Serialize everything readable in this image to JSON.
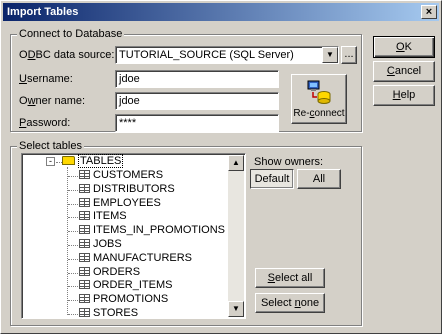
{
  "dialog": {
    "title": "Import Tables",
    "close_label": "×"
  },
  "connect_group": {
    "label": "Connect to Database",
    "odbc_label": "ODBC data source:",
    "odbc_value": "TUTORIAL_SOURCE (SQL Server)",
    "browse_label": "...",
    "username_label": "Username:",
    "username_value": "jdoe",
    "owner_label": "Owner name:",
    "owner_value": "jdoe",
    "password_label": "Password:",
    "password_value": "****",
    "reconnect_label": "Re-connect"
  },
  "select_group": {
    "label": "Select tables",
    "root": "TABLES",
    "tables": [
      "CUSTOMERS",
      "DISTRIBUTORS",
      "EMPLOYEES",
      "ITEMS",
      "ITEMS_IN_PROMOTIONS",
      "JOBS",
      "MANUFACTURERS",
      "ORDERS",
      "ORDER_ITEMS",
      "PROMOTIONS",
      "STORES"
    ],
    "show_owners_label": "Show owners:",
    "default_label": "Default",
    "all_label": "All",
    "select_all_label": "Select all",
    "select_none_label": "Select none"
  },
  "buttons": {
    "ok": "OK",
    "cancel": "Cancel",
    "help": "Help"
  }
}
